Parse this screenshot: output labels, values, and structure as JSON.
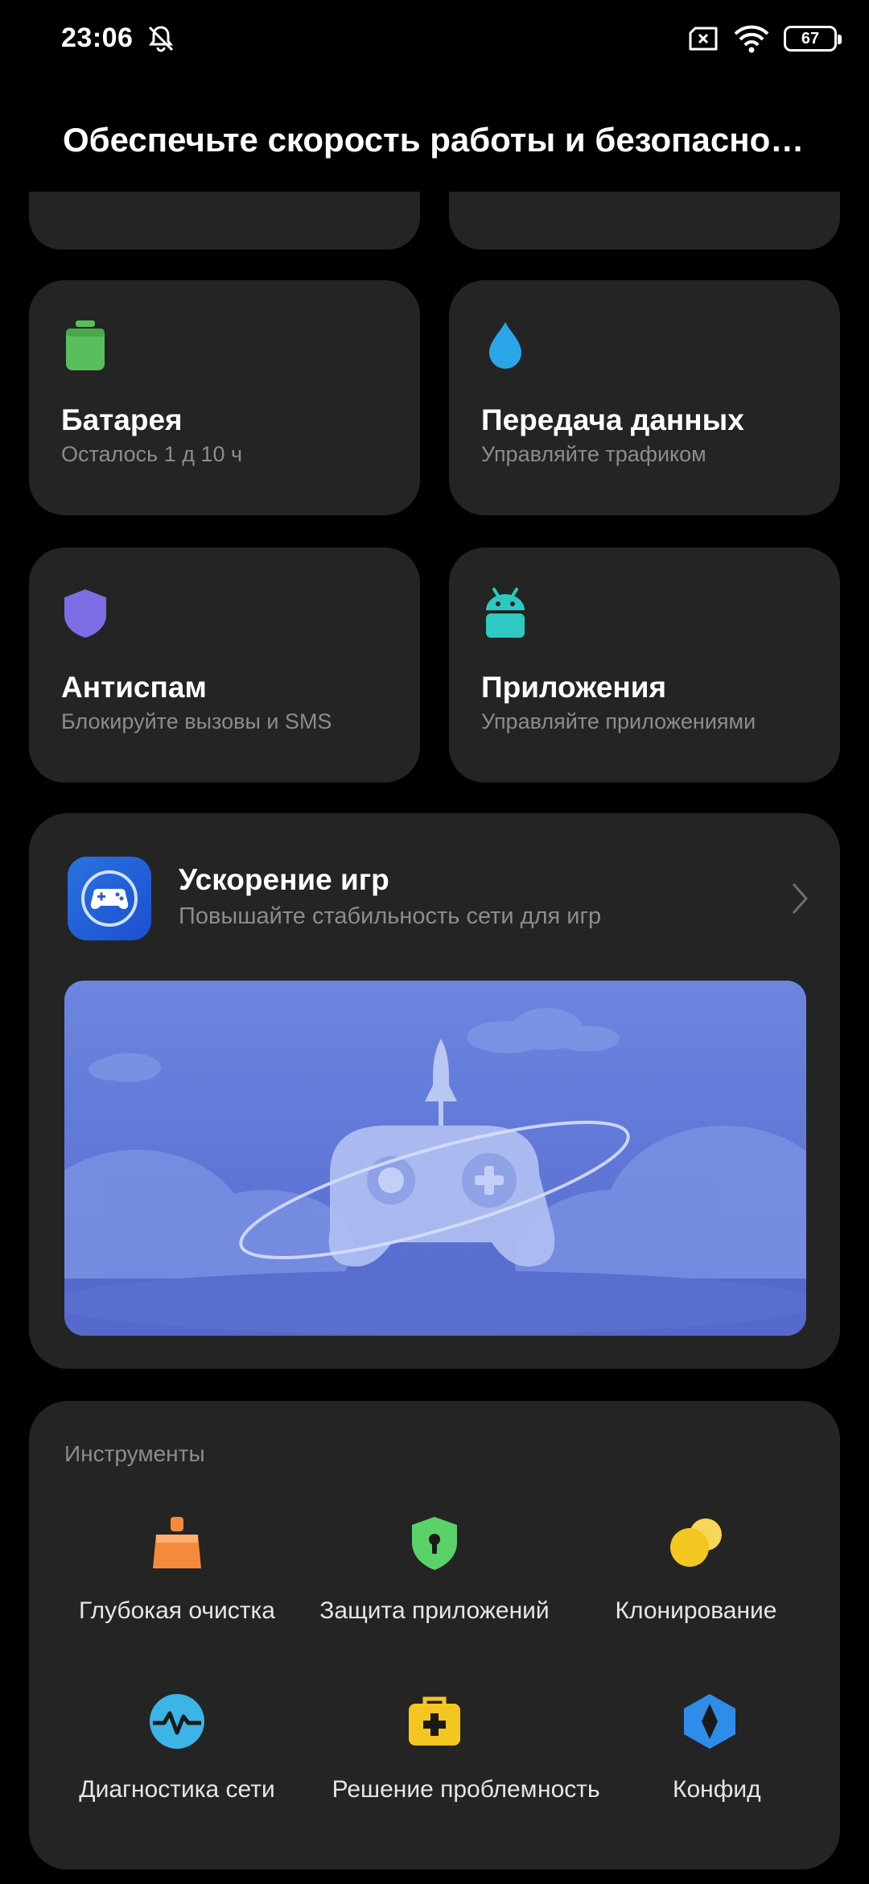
{
  "status_bar": {
    "time": "23:06",
    "battery": "67"
  },
  "header": {
    "title": "Обеспечьте скорость работы и безопасно…"
  },
  "tiles": [
    {
      "title": "Батарея",
      "subtitle": "Осталось 1 д 10 ч",
      "icon": "battery-icon",
      "color": "#5bbe5c"
    },
    {
      "title": "Передача данных",
      "subtitle": "Управляйте трафиком",
      "icon": "water-drop-icon",
      "color": "#2aa6e8"
    },
    {
      "title": "Антиспам",
      "subtitle": "Блокируйте вызовы и SMS",
      "icon": "shield-icon",
      "color": "#7d6ee6"
    },
    {
      "title": "Приложения",
      "subtitle": "Управляйте приложениями",
      "icon": "android-icon",
      "color": "#2ec9c2"
    }
  ],
  "game": {
    "title": "Ускорение игр",
    "subtitle": "Повышайте стабильность сети для игр",
    "icon": "gamepad-icon",
    "banner_color": "#6478d8"
  },
  "tools": {
    "label": "Инструменты",
    "items": [
      {
        "label": "Глубокая очистка",
        "icon": "broom-icon",
        "color": "#f58a3c"
      },
      {
        "label": "Защита приложений",
        "icon": "lock-shield-icon",
        "color": "#5bd16a"
      },
      {
        "label": "Клонирование",
        "icon": "clone-circles-icon",
        "color": "#f4c720"
      },
      {
        "label": "Диагностика сети",
        "icon": "network-pulse-icon",
        "color": "#3cb4e6"
      },
      {
        "label": "Решение проблем",
        "icon": "first-aid-kit-icon",
        "color": "#f4c720"
      },
      {
        "label": "ность",
        "icon": "privacy-icon"
      },
      {
        "label": "Конфид",
        "icon": "diamond-icon",
        "color": "#2f8ce8"
      }
    ]
  }
}
